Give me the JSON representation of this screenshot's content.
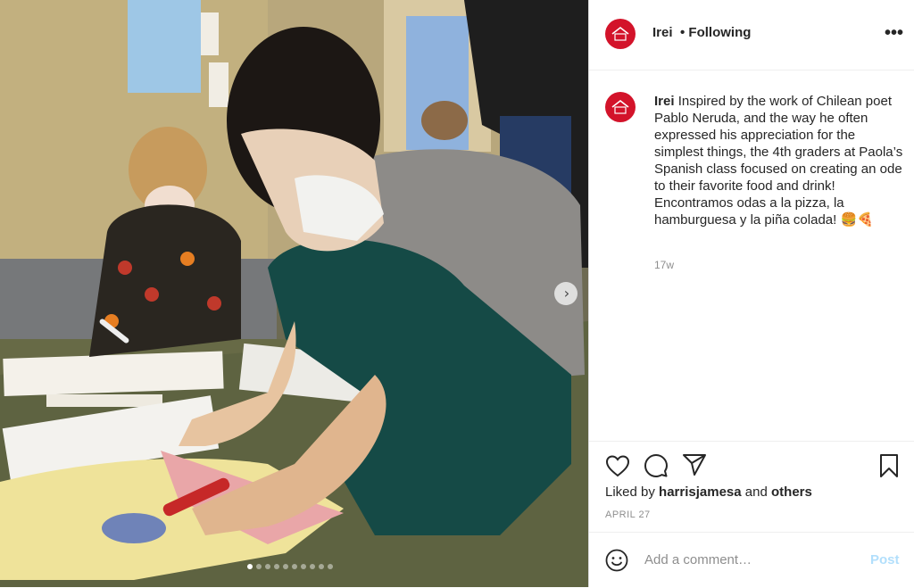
{
  "header": {
    "username": "Irei",
    "following_label": "• Following",
    "more_icon": "more-options-icon"
  },
  "caption": {
    "username": "Irei",
    "text": "Inspired by the work of Chilean poet Pablo Neruda, and the way he often expressed his appreciation for the simplest things, the 4th graders at Paola’s Spanish class focused on creating an ode to their favorite food and drink! Encontramos odas a la pizza, la hamburguesa y la piña colada! 🍔🍕",
    "time": "17w"
  },
  "actions": {
    "like_icon": "heart-icon",
    "comment_icon": "comment-icon",
    "share_icon": "share-icon",
    "save_icon": "bookmark-icon"
  },
  "likes": {
    "prefix": "Liked by",
    "user": "harrisjamesa",
    "joiner": "and",
    "others": "others"
  },
  "date": "APRIL 27",
  "comment": {
    "placeholder": "Add a comment…",
    "post_label": "Post"
  },
  "media": {
    "slide_count": 10,
    "active_slide": 1
  },
  "colors": {
    "brand": "#d3132a",
    "post_disabled": "#b2dffc",
    "secondary_text": "#8e8e8e"
  }
}
